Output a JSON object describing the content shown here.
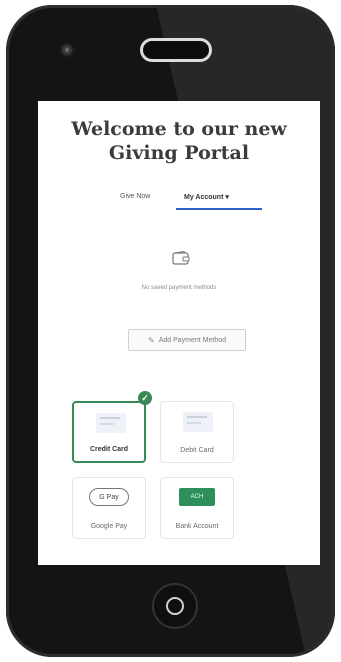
{
  "portal": {
    "title_line1": "Welcome to our new",
    "title_line2": "Giving Portal"
  },
  "tabs": [
    {
      "label": "Give Now"
    },
    {
      "label": "My Account ▾"
    }
  ],
  "payment": {
    "empty_text": "No saved payment methods",
    "add_label": "Add Payment Method",
    "options": [
      {
        "label": "Credit Card",
        "selected": true
      },
      {
        "label": "Debit Card",
        "selected": false
      },
      {
        "label": "Google Pay",
        "badge": "G Pay"
      },
      {
        "label": "Bank Account",
        "badge": "ACH"
      }
    ]
  },
  "colors": {
    "accent": "#2d63c8",
    "selected": "#3a8a58"
  }
}
